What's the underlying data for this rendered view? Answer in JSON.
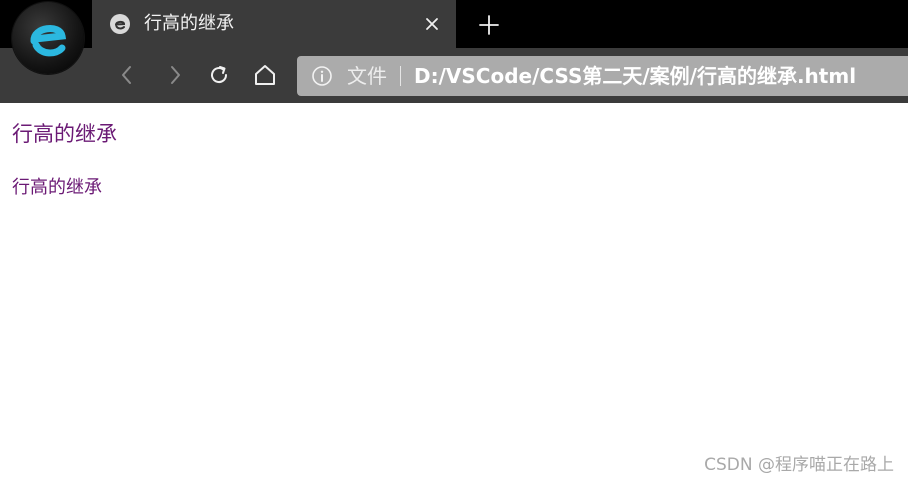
{
  "browser": {
    "tab": {
      "title": "行高的继承",
      "favicon": "edge-favicon-icon"
    },
    "address": {
      "scheme_label": "文件",
      "url": "D:/VSCode/CSS第二天/案例/行高的继承.html"
    },
    "colors": {
      "titlebar": "#000000",
      "toolbar": "#3b3b3b",
      "addressbar": "#ababab"
    }
  },
  "page": {
    "line1": "行高的继承",
    "line2": "行高的继承",
    "text_color": "#6b1a75"
  },
  "watermark": "CSDN @程序喵正在路上"
}
